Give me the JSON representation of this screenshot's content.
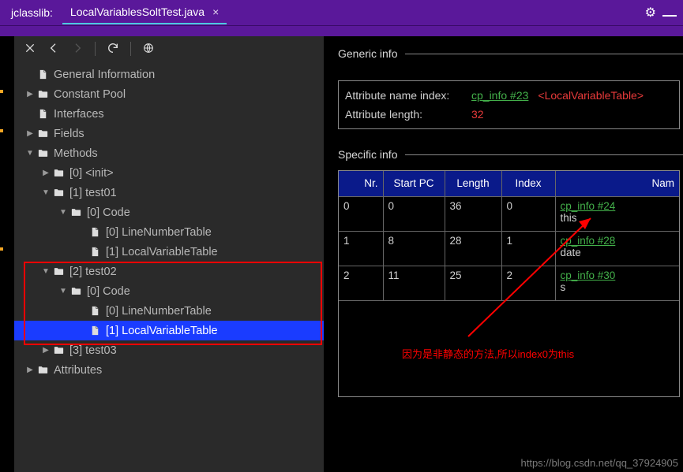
{
  "titlebar": {
    "app": "jclasslib:",
    "tab": "LocalVariablesSoltTest.java"
  },
  "tree": {
    "items": [
      {
        "ind": 1,
        "caret": "",
        "icon": "file",
        "label": "General Information"
      },
      {
        "ind": 1,
        "caret": "right",
        "icon": "folder",
        "label": "Constant Pool"
      },
      {
        "ind": 1,
        "caret": "",
        "icon": "file",
        "label": "Interfaces"
      },
      {
        "ind": 1,
        "caret": "right",
        "icon": "folder",
        "label": "Fields"
      },
      {
        "ind": 1,
        "caret": "down",
        "icon": "folder",
        "label": "Methods"
      },
      {
        "ind": 2,
        "caret": "right",
        "icon": "folder",
        "label": "[0] <init>"
      },
      {
        "ind": 2,
        "caret": "down",
        "icon": "folder",
        "label": "[1] test01"
      },
      {
        "ind": 3,
        "caret": "down",
        "icon": "folder",
        "label": "[0] Code"
      },
      {
        "ind": 4,
        "caret": "",
        "icon": "file",
        "label": "[0] LineNumberTable"
      },
      {
        "ind": 4,
        "caret": "",
        "icon": "file",
        "label": "[1] LocalVariableTable"
      },
      {
        "ind": 2,
        "caret": "down",
        "icon": "folder",
        "label": "[2] test02"
      },
      {
        "ind": 3,
        "caret": "down",
        "icon": "folder",
        "label": "[0] Code"
      },
      {
        "ind": 4,
        "caret": "",
        "icon": "file",
        "label": "[0] LineNumberTable"
      },
      {
        "ind": 4,
        "caret": "",
        "icon": "file",
        "label": "[1] LocalVariableTable",
        "selected": true
      },
      {
        "ind": 2,
        "caret": "right",
        "icon": "folder",
        "label": "[3] test03"
      },
      {
        "ind": 1,
        "caret": "right",
        "icon": "folder",
        "label": "Attributes"
      }
    ]
  },
  "detail": {
    "generic_head": "Generic info",
    "attr_name_label": "Attribute name index:",
    "attr_name_link": "cp_info #23",
    "attr_name_val": "<LocalVariableTable>",
    "attr_len_label": "Attribute length:",
    "attr_len_val": "32",
    "specific_head": "Specific info",
    "cols": [
      "Nr.",
      "Start PC",
      "Length",
      "Index",
      "Nam"
    ],
    "rows": [
      {
        "nr": "0",
        "start": "0",
        "len": "36",
        "idx": "0",
        "link": "cp_info #24",
        "sub": "this"
      },
      {
        "nr": "1",
        "start": "8",
        "len": "28",
        "idx": "1",
        "link": "cp_info #28",
        "sub": "date"
      },
      {
        "nr": "2",
        "start": "11",
        "len": "25",
        "idx": "2",
        "link": "cp_info #30",
        "sub": "s"
      }
    ]
  },
  "annotation": "因为是非静态的方法,所以index0为this",
  "watermark": "https://blog.csdn.net/qq_37924905"
}
